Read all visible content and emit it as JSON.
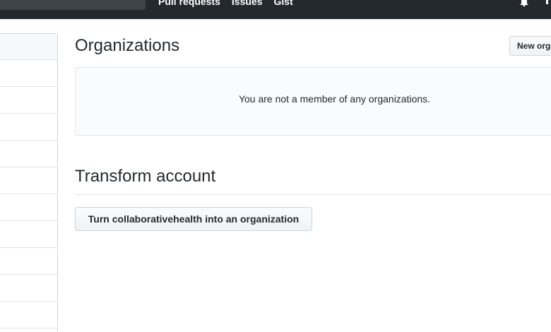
{
  "header": {
    "nav": [
      "Pull requests",
      "Issues",
      "Gist"
    ],
    "bell_icon": "bell-icon"
  },
  "sidebar": {
    "item_count": 11
  },
  "main": {
    "title": "Organizations",
    "new_org_label": "New orga",
    "empty_message": "You are not a member of any organizations.",
    "transform_heading": "Transform account",
    "transform_button": "Turn collaborativehealth into an organization"
  }
}
